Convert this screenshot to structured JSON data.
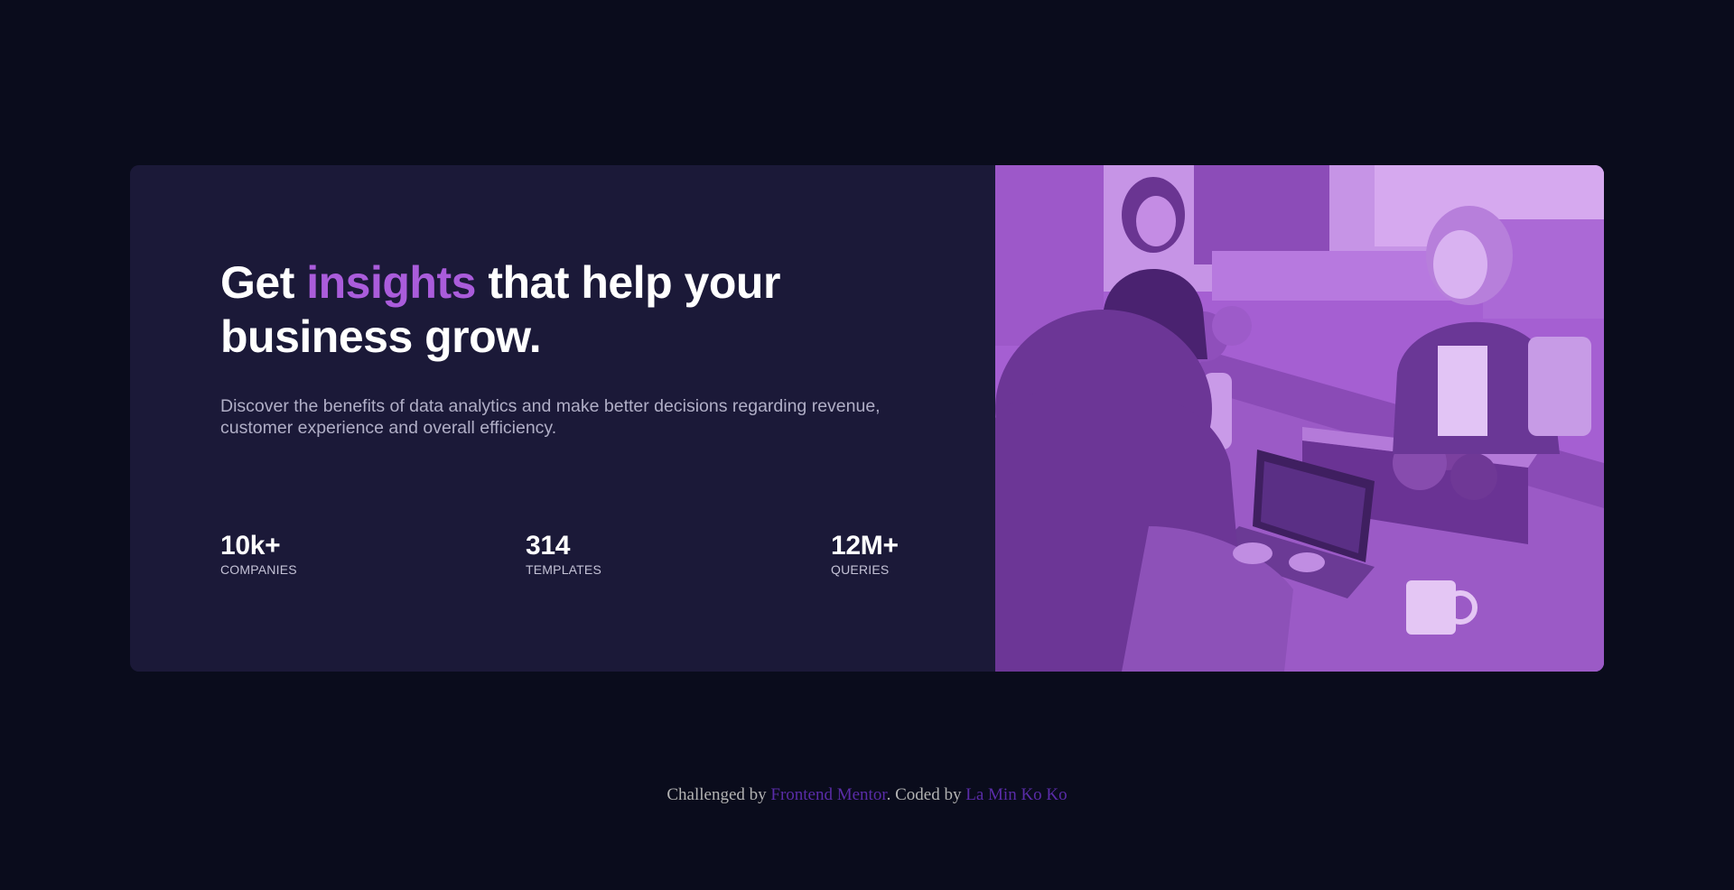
{
  "card": {
    "headline": {
      "before": "Get ",
      "accent": "insights",
      "after": " that help your business grow."
    },
    "description": "Discover the benefits of data analytics and make better decisions regarding revenue, customer experience and overall efficiency.",
    "stats": [
      {
        "value": "10k+",
        "label": "companies"
      },
      {
        "value": "314",
        "label": "templates"
      },
      {
        "value": "12M+",
        "label": "queries"
      }
    ],
    "image": {
      "icon": "photo-office-team",
      "tint_color": "#aa5cdb"
    }
  },
  "attribution": {
    "prefix": "Challenged by ",
    "link1": "Frontend Mentor",
    "middle": ". Coded by ",
    "link2": "La Min Ko Ko"
  },
  "colors": {
    "page_background": "#0a0c1c",
    "card_background": "#1b1938",
    "accent": "#aa5cdb",
    "link": "#5a2ca8"
  }
}
